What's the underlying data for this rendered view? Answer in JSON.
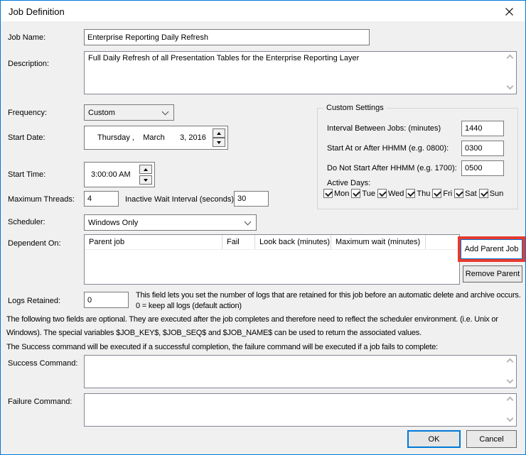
{
  "colors": {
    "accent": "#0078d7",
    "annotation_red": "#e8392f",
    "titlebar_bg": "#ffffff",
    "dialog_bg": "#f0f0f0"
  },
  "window": {
    "title": "Job Definition"
  },
  "fields": {
    "job_name": {
      "label": "Job Name:",
      "value": "Enterprise Reporting Daily Refresh"
    },
    "description": {
      "label": "Description:",
      "value": "Full Daily Refresh of all Presentation Tables for the Enterprise Reporting Layer"
    },
    "frequency": {
      "label": "Frequency:",
      "value": "Custom"
    },
    "start_date": {
      "label": "Start Date:",
      "value": "Thursday ,    March       3, 2016"
    },
    "start_time": {
      "label": "Start Time:",
      "value": "3:00:00 AM"
    },
    "maximum_threads": {
      "label": "Maximum Threads:",
      "value": "4"
    },
    "inactive_wait": {
      "label": "Inactive Wait Interval (seconds):",
      "value": "30"
    },
    "scheduler": {
      "label": "Scheduler:",
      "value": "Windows Only"
    },
    "dependent_on": {
      "label": "Dependent On:"
    },
    "logs_retained": {
      "label": "Logs Retained:",
      "value": "0",
      "help": "This field lets you set the number of logs that are retained for this job before an automatic delete and archive occurs. 0 = keep all logs (default action)"
    },
    "success_command": {
      "label": "Success Command:",
      "value": ""
    },
    "failure_command": {
      "label": "Failure Command:",
      "value": ""
    }
  },
  "custom_settings": {
    "title": "Custom Settings",
    "interval": {
      "label": "Interval Between Jobs: (minutes)",
      "value": "1440"
    },
    "start_at": {
      "label": "Start At or After HHMM (e.g. 0800):",
      "value": "0300"
    },
    "do_not_start": {
      "label": "Do Not Start After HHMM (e.g. 1700):",
      "value": "0500"
    },
    "active_days_label": "Active Days:",
    "days": [
      {
        "label": "Mon",
        "checked": true
      },
      {
        "label": "Tue",
        "checked": true
      },
      {
        "label": "Wed",
        "checked": true
      },
      {
        "label": "Thu",
        "checked": true
      },
      {
        "label": "Fri",
        "checked": true
      },
      {
        "label": "Sat",
        "checked": true
      },
      {
        "label": "Sun",
        "checked": true
      }
    ]
  },
  "dependents_table": {
    "columns": [
      "Parent job",
      "Fail",
      "Look back (minutes)",
      "Maximum wait (minutes)"
    ],
    "rows": []
  },
  "notes": {
    "optional_fields": "The following two fields are optional. They are executed after the job completes and therefore need to reflect the scheduler environment. (i.e. Unix or Windows). The special variables $JOB_KEY$, $JOB_SEQ$ and $JOB_NAME$ can be used to return the associated values.",
    "success_failure": "The Success command will be executed if a successful completion, the failure command will be executed if a job fails to complete:"
  },
  "buttons": {
    "add_parent": "Add Parent Job",
    "remove_parent": "Remove Parent",
    "ok": "OK",
    "cancel": "Cancel"
  }
}
